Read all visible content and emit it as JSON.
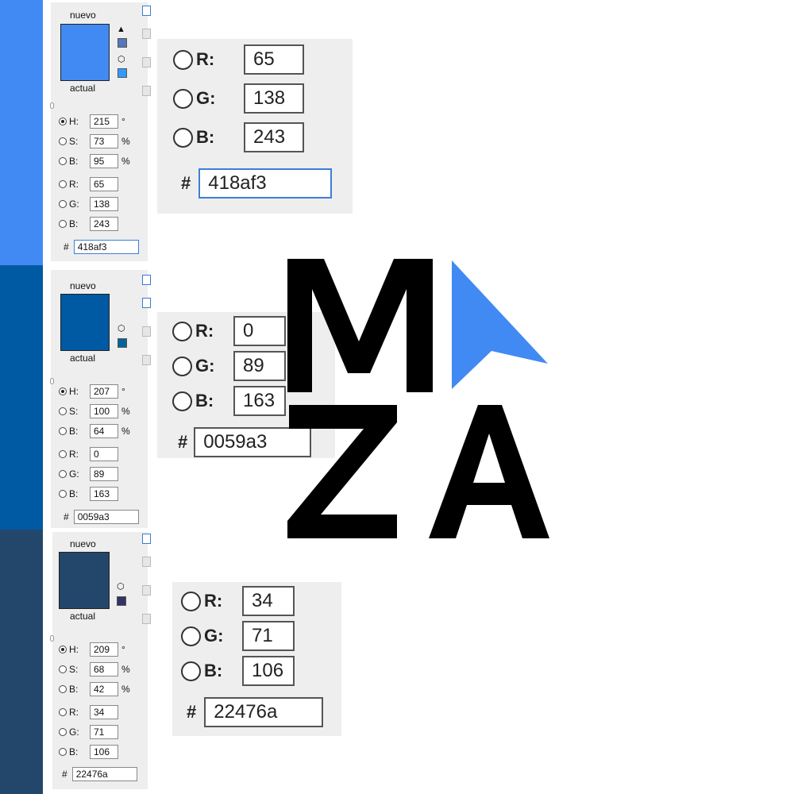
{
  "logo": {
    "alt": "MZA logo",
    "letter_color": "#000000",
    "arrow_color": "#418af3"
  },
  "swatches": [
    {
      "color": "#418af3",
      "new_label": "nuevo",
      "current_label": "actual",
      "fields": {
        "h": {
          "label": "H:",
          "value": "215",
          "unit": "°"
        },
        "s": {
          "label": "S:",
          "value": "73",
          "unit": "%"
        },
        "bri": {
          "label": "B:",
          "value": "95",
          "unit": "%"
        },
        "r": {
          "label": "R:",
          "value": "65"
        },
        "g": {
          "label": "G:",
          "value": "138"
        },
        "b": {
          "label": "B:",
          "value": "243"
        }
      },
      "hex": {
        "label": "#",
        "value": "418af3"
      },
      "zoom": {
        "r": {
          "label": "R:",
          "value": "65"
        },
        "g": {
          "label": "G:",
          "value": "138"
        },
        "b": {
          "label": "B:",
          "value": "243"
        },
        "hex": {
          "label": "#",
          "value": "418af3"
        }
      }
    },
    {
      "color": "#0059a3",
      "new_label": "nuevo",
      "current_label": "actual",
      "fields": {
        "h": {
          "label": "H:",
          "value": "207",
          "unit": "°"
        },
        "s": {
          "label": "S:",
          "value": "100",
          "unit": "%"
        },
        "bri": {
          "label": "B:",
          "value": "64",
          "unit": "%"
        },
        "r": {
          "label": "R:",
          "value": "0"
        },
        "g": {
          "label": "G:",
          "value": "89"
        },
        "b": {
          "label": "B:",
          "value": "163"
        }
      },
      "hex": {
        "label": "#",
        "value": "0059a3"
      },
      "zoom": {
        "r": {
          "label": "R:",
          "value": "0"
        },
        "g": {
          "label": "G:",
          "value": "89"
        },
        "b": {
          "label": "B:",
          "value": "163"
        },
        "hex": {
          "label": "#",
          "value": "0059a3"
        }
      }
    },
    {
      "color": "#22476a",
      "new_label": "nuevo",
      "current_label": "actual",
      "fields": {
        "h": {
          "label": "H:",
          "value": "209",
          "unit": "°"
        },
        "s": {
          "label": "S:",
          "value": "68",
          "unit": "%"
        },
        "bri": {
          "label": "B:",
          "value": "42",
          "unit": "%"
        },
        "r": {
          "label": "R:",
          "value": "34"
        },
        "g": {
          "label": "G:",
          "value": "71"
        },
        "b": {
          "label": "B:",
          "value": "106"
        }
      },
      "hex": {
        "label": "#",
        "value": "22476a"
      },
      "zoom": {
        "r": {
          "label": "R:",
          "value": "34"
        },
        "g": {
          "label": "G:",
          "value": "71"
        },
        "b": {
          "label": "B:",
          "value": "106"
        },
        "hex": {
          "label": "#",
          "value": "22476a"
        }
      }
    }
  ]
}
